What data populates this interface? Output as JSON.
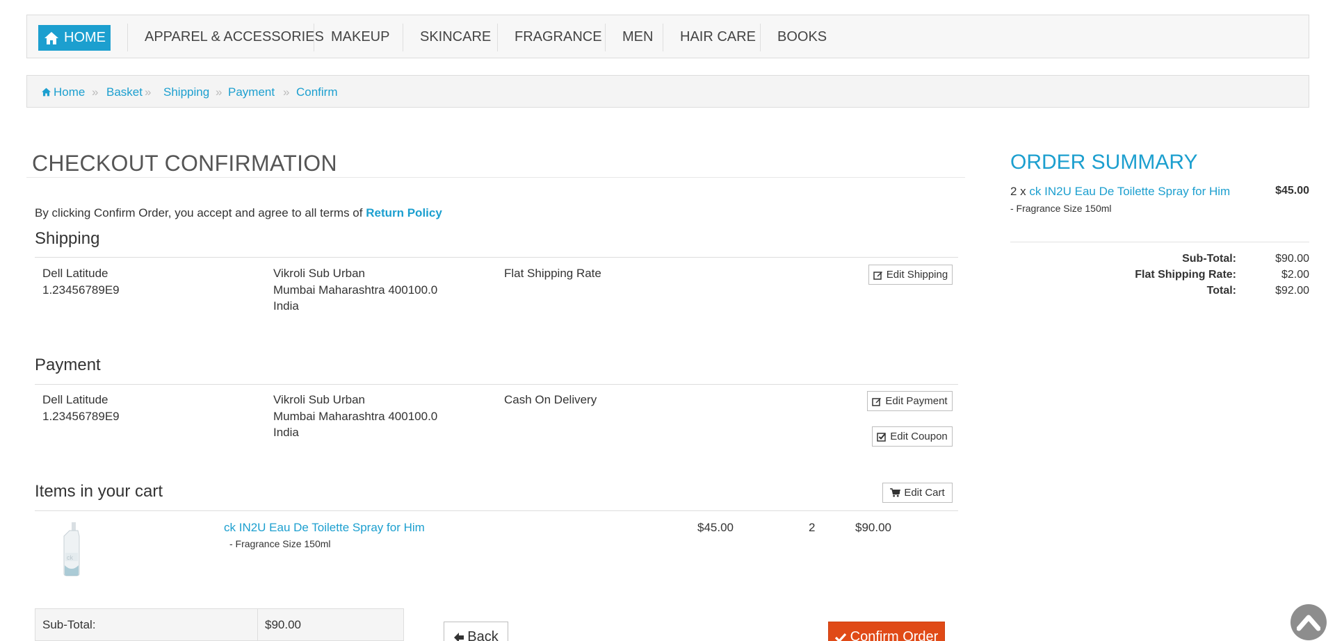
{
  "nav": {
    "home_label": "HOME",
    "items": [
      "APPAREL & ACCESSORIES",
      "MAKEUP",
      "SKINCARE",
      "FRAGRANCE",
      "MEN",
      "HAIR CARE",
      "BOOKS"
    ]
  },
  "breadcrumb": [
    "Home",
    "Basket",
    "Shipping",
    "Payment",
    "Confirm"
  ],
  "page": {
    "title": "CHECKOUT CONFIRMATION",
    "terms_text": "By clicking Confirm Order, you accept and agree to all terms of",
    "terms_link": "Return Policy"
  },
  "shipping": {
    "title": "Shipping",
    "name": "Dell Latitude",
    "phone": "1.23456789E9",
    "address_line1": "Vikroli Sub Urban",
    "address_line2": "Mumbai Maharashtra 400100.0",
    "country": "India",
    "method": "Flat Shipping Rate",
    "edit_label": "Edit Shipping"
  },
  "payment": {
    "title": "Payment",
    "name": "Dell Latitude",
    "phone": "1.23456789E9",
    "address_line1": "Vikroli Sub Urban",
    "address_line2": "Mumbai Maharashtra 400100.0",
    "country": "India",
    "method": "Cash On Delivery",
    "edit_label": "Edit Payment",
    "coupon_label": "Edit Coupon"
  },
  "cart": {
    "title": "Items in your cart",
    "edit_label": "Edit Cart",
    "item": {
      "name": "ck IN2U Eau De Toilette Spray for Him",
      "option": "- Fragrance Size 150ml",
      "price": "$45.00",
      "qty": "2",
      "total": "$90.00"
    }
  },
  "totals": {
    "subtotal_label": "Sub-Total:",
    "subtotal_value": "$90.00"
  },
  "actions": {
    "back_label": "Back",
    "confirm_label": "Confirm Order"
  },
  "summary": {
    "title": "ORDER SUMMARY",
    "qty_prefix": "2 x",
    "item_name": "ck IN2U Eau De Toilette Spray for Him",
    "item_price": "$45.00",
    "item_option": "- Fragrance Size 150ml",
    "subtotal_label": "Sub-Total:",
    "subtotal_value": "$90.00",
    "shipping_label": "Flat Shipping Rate:",
    "shipping_value": "$2.00",
    "total_label": "Total:",
    "total_value": "$92.00"
  },
  "colors": {
    "accent": "#1c9fcf",
    "confirm": "#e04a17"
  }
}
